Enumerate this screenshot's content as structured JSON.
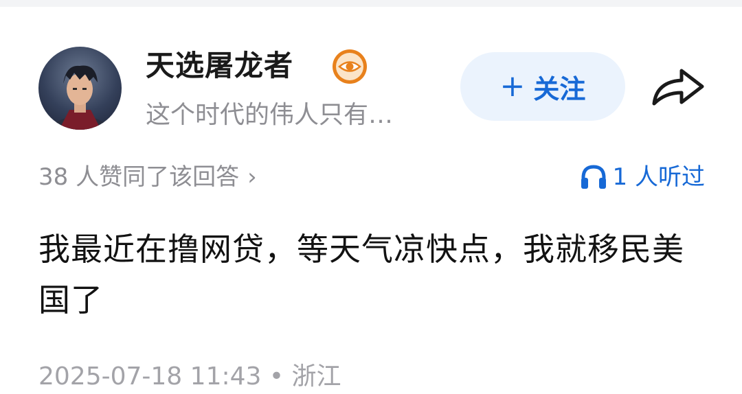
{
  "author": {
    "name": "天选屠龙者",
    "bio": "这个时代的伟人只有…",
    "badge_icon": "eye-badge-icon"
  },
  "actions": {
    "follow_plus": "+",
    "follow_label": "关注",
    "share_icon": "share-arrow-icon"
  },
  "stats": {
    "likes_text": "38 人赞同了该回答",
    "likes_chevron": "›",
    "listen_text": "1 人听过",
    "listen_icon": "headphones-icon"
  },
  "answer": {
    "content": "我最近在撸网贷，等天气凉快点，我就移民美国了"
  },
  "meta": {
    "text": "2025-07-18 11:43 • 浙江"
  },
  "colors": {
    "accent": "#1769d6",
    "follow_bg": "#ebf3fd",
    "badge": "#e8811c",
    "muted": "#8e8e93"
  }
}
